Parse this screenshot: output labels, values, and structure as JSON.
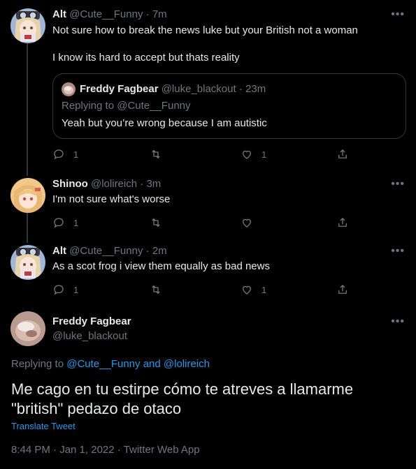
{
  "tweets": [
    {
      "name": "Alt",
      "handle": "@Cute__Funny",
      "time": "7m",
      "text_line1": "Not sure how to break the news luke but your British not a woman",
      "text_line2": "I know its hard to accept but thats reality",
      "quote": {
        "name": "Freddy Fagbear",
        "handle": "@luke_blackout",
        "time": "23m",
        "replying": "Replying to @Cute__Funny",
        "text": "Yeah but you’re wrong because I am autistic"
      },
      "replies": "1",
      "likes": "1"
    },
    {
      "name": "Shinoo",
      "handle": "@lolireich",
      "time": "3m",
      "text": "I'm not sure what's worse",
      "replies": "1"
    },
    {
      "name": "Alt",
      "handle": "@Cute__Funny",
      "time": "2m",
      "text": "As a scot frog i view them equally as bad news",
      "replies": "1",
      "likes": "1"
    }
  ],
  "main": {
    "name": "Freddy Fagbear",
    "handle": "@luke_blackout",
    "replying_prefix": "Replying to",
    "replying_user1": "@Cute__Funny",
    "replying_and": "and",
    "replying_user2": "@lolireich",
    "text_line1": "Me cago en tu estirpe cómo te atreves a llamarme",
    "text_line2": "\"british\" pedazo de otaco",
    "translate": "Translate Tweet",
    "meta": "8:44 PM · Jan 1, 2022 · Twitter Web App"
  },
  "ui": {
    "dot": "·",
    "more": "•••"
  },
  "colors": {
    "link": "#1d9bf0",
    "muted": "#71767b",
    "text": "#e7e9ea",
    "border": "#333639"
  },
  "icons": [
    "reply-icon",
    "retweet-icon",
    "like-icon",
    "share-icon",
    "more-icon"
  ]
}
